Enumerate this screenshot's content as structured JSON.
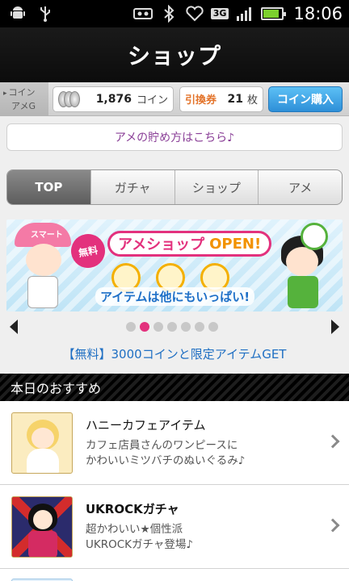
{
  "status_bar": {
    "icons_left": [
      "android-icon",
      "usb-icon"
    ],
    "icons_right": [
      "voicemail-icon",
      "bluetooth-icon",
      "heart-app-icon",
      "3g-icon",
      "signal-icon",
      "battery-icon"
    ],
    "network": "3G",
    "battery_level": 0.85,
    "time": "18:06"
  },
  "header": {
    "title": "ショップ"
  },
  "coin_bar": {
    "tag_line1": "コイン",
    "tag_line2": "アメG",
    "coins": "1,876",
    "coin_unit": "コイン",
    "ticket_label": "引換券",
    "ticket_count": "21",
    "ticket_unit": "枚",
    "buy_button": "コイン購入"
  },
  "ame_link": "アメの貯め方はこちら♪",
  "tabs": [
    {
      "label": "TOP",
      "active": true
    },
    {
      "label": "ガチャ",
      "active": false
    },
    {
      "label": "ショップ",
      "active": false
    },
    {
      "label": "アメ",
      "active": false
    }
  ],
  "banner": {
    "badge": "無料",
    "title": "アメショップ",
    "title_open": "OPEN!",
    "subtitle": "アイテムは他にもいっぱい!",
    "hat_label": "スマート"
  },
  "carousel": {
    "pages": 7,
    "active_index": 1
  },
  "promo_link": "【無料】3000コインと限定アイテムGET",
  "section": {
    "title": "本日のおすすめ"
  },
  "list": [
    {
      "title": "ハニーカフェアイテム",
      "desc_line1": "カフェ店員さんのワンピースに",
      "desc_line2": "かわいいミツバチのぬいぐるみ♪"
    },
    {
      "title": "UKROCKガチャ",
      "desc_line1": "超かわいい★個性派",
      "desc_line2": "UKROCKガチャ登場♪"
    }
  ],
  "colors": {
    "accent_pink": "#e3317d",
    "link_blue": "#1f6fc3",
    "ame_purple": "#8a3f97",
    "ticket_orange": "#e3742b",
    "buy_blue": "#2e8fd8"
  }
}
